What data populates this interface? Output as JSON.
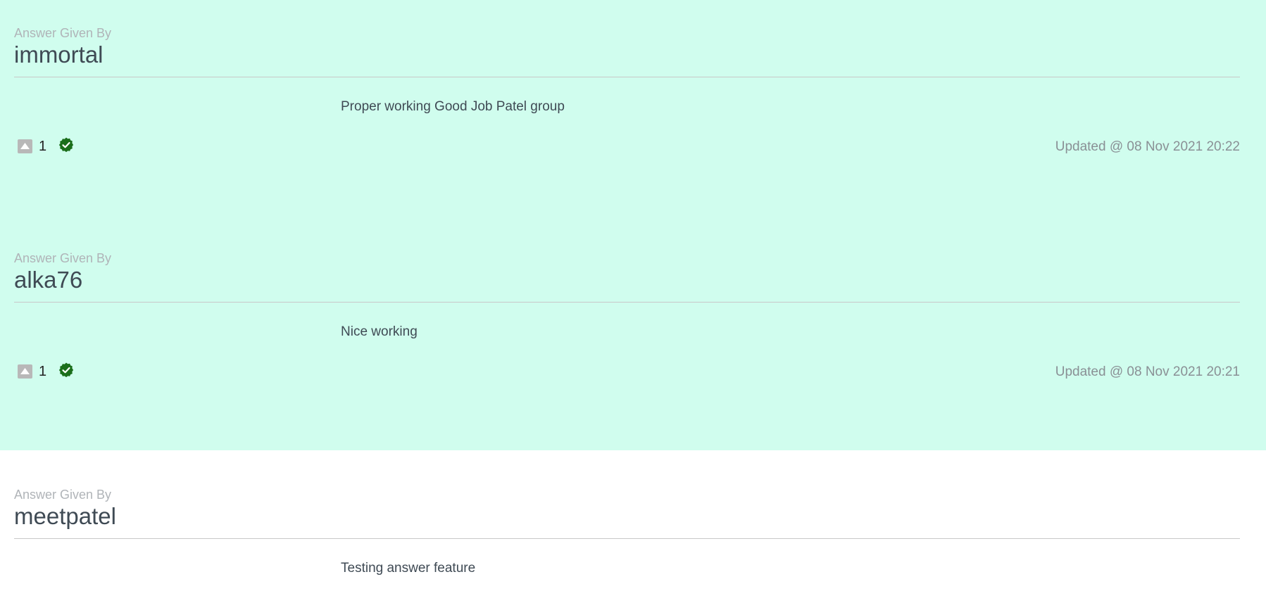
{
  "answers": [
    {
      "label": "Answer Given By",
      "user": "immortal",
      "text": "Proper working Good Job Patel group",
      "votes": "1",
      "updated": "Updated @ 08 Nov 2021 20:22",
      "accepted": true
    },
    {
      "label": "Answer Given By",
      "user": "alka76",
      "text": "Nice working",
      "votes": "1",
      "updated": "Updated @ 08 Nov 2021 20:21",
      "accepted": true
    },
    {
      "label": "Answer Given By",
      "user": "meetpatel",
      "text": "Testing answer feature",
      "accepted": false
    }
  ],
  "colors": {
    "accepted_bg": "#d0fdee",
    "verified_badge": "#1b6e1b",
    "vote_box": "#b8b8b8"
  },
  "icons": {
    "upvote": "caret-up-icon",
    "verified": "verified-badge-icon"
  }
}
